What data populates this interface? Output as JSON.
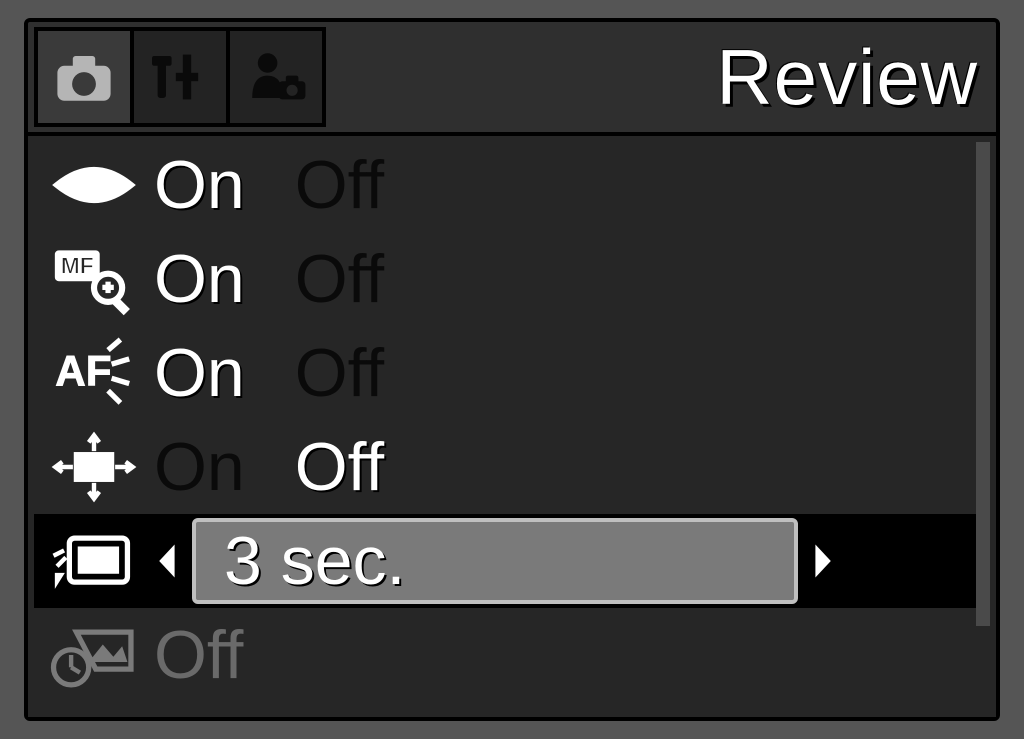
{
  "title": "Review",
  "tabs": [
    {
      "id": "camera",
      "icon": "camera-icon",
      "active": true
    },
    {
      "id": "tools",
      "icon": "wrench-hammer-icon",
      "active": false
    },
    {
      "id": "custom",
      "icon": "person-camera-icon",
      "active": false
    }
  ],
  "rows": [
    {
      "icon": "eye-icon",
      "optA": "On",
      "optB": "Off",
      "selected": "A"
    },
    {
      "icon": "mf-zoom-icon",
      "optA": "On",
      "optB": "Off",
      "selected": "A"
    },
    {
      "icon": "af-assist-icon",
      "optA": "On",
      "optB": "Off",
      "selected": "A"
    },
    {
      "icon": "frame-expand-icon",
      "optA": "On",
      "optB": "Off",
      "selected": "B"
    }
  ],
  "selected_row": {
    "icon": "review-display-icon",
    "value": "3 sec."
  },
  "dim_row": {
    "icon": "date-stamp-icon",
    "value": "Off"
  }
}
